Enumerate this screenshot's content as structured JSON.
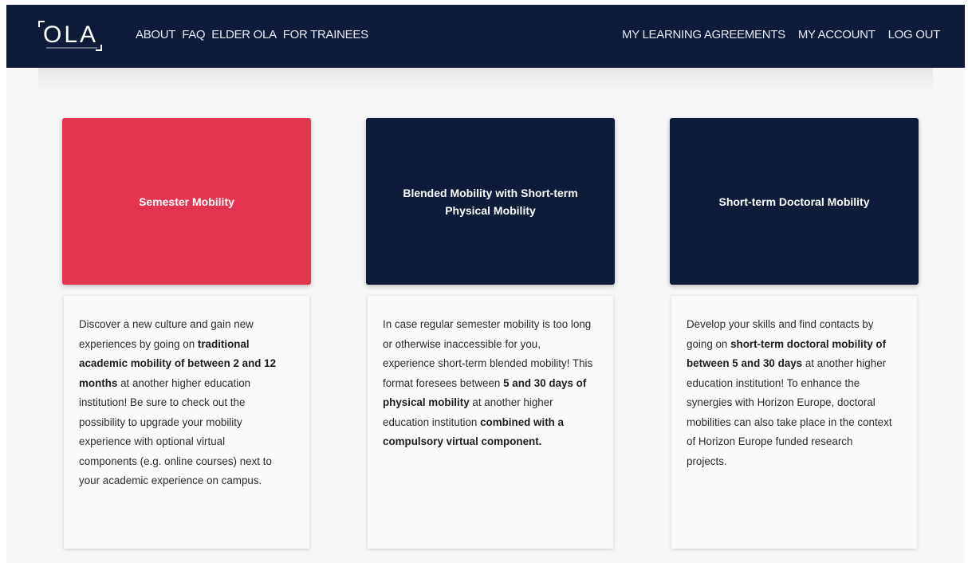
{
  "brand": {
    "logo_text": "OLA",
    "colors": {
      "navbar": "#0e1c3a",
      "accent": "#e3344f",
      "card_dark": "#0e1c3a"
    }
  },
  "nav": {
    "left": [
      {
        "label": "ABOUT"
      },
      {
        "label": "FAQ"
      },
      {
        "label": "ELDER OLA"
      },
      {
        "label": "FOR TRAINEES"
      }
    ],
    "right": [
      {
        "label": "MY LEARNING AGREEMENTS"
      },
      {
        "label": "MY ACCOUNT"
      },
      {
        "label": "LOG OUT"
      }
    ]
  },
  "cards": [
    {
      "title": "Semester Mobility",
      "color": "#e3344f",
      "body": [
        {
          "text": "Discover a new culture and gain new experiences by going on ",
          "bold": false
        },
        {
          "text": "traditional academic mobility of between 2 and 12 months",
          "bold": true
        },
        {
          "text": " at another higher education institution! Be sure to check out the possibility to upgrade your mobility experience with optional virtual components (e.g. online courses) next to your academic experience on campus.",
          "bold": false
        }
      ]
    },
    {
      "title": "Blended Mobility with Short-term Physical Mobility",
      "color": "#0e1c3a",
      "body": [
        {
          "text": "In case regular semester mobility is too long or otherwise inaccessible for you, experience short-term blended mobility! This format foresees between ",
          "bold": false
        },
        {
          "text": "5 and 30 days of physical mobility",
          "bold": true
        },
        {
          "text": " at another higher education institution ",
          "bold": false
        },
        {
          "text": "combined with a compulsory virtual component.",
          "bold": true
        }
      ]
    },
    {
      "title": "Short-term Doctoral Mobility",
      "color": "#0e1c3a",
      "body": [
        {
          "text": "Develop your skills and find contacts by going on ",
          "bold": false
        },
        {
          "text": "short-term doctoral mobility of between 5 and 30 days",
          "bold": true
        },
        {
          "text": " at another higher education institution! To enhance the synergies with Horizon Europe, doctoral mobilities can also take place in the context of Horizon Europe funded research projects.",
          "bold": false
        }
      ]
    }
  ]
}
